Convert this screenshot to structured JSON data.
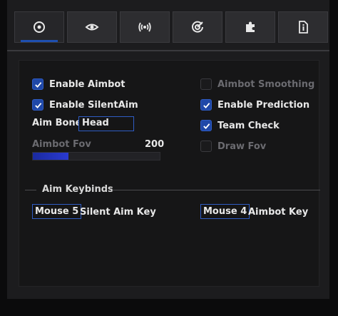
{
  "tabs": [
    {
      "icon": "target-icon",
      "active": true
    },
    {
      "icon": "eye-icon",
      "active": false
    },
    {
      "icon": "broadcast-icon",
      "active": false
    },
    {
      "icon": "crosshair-icon",
      "active": false
    },
    {
      "icon": "puzzle-icon",
      "active": false
    },
    {
      "icon": "info-icon",
      "active": false
    }
  ],
  "left": {
    "enable_aimbot": {
      "label": "Enable Aimbot",
      "checked": true
    },
    "enable_silentaim": {
      "label": "Enable SilentAim",
      "checked": true
    },
    "aim_bone": {
      "label": "Aim Bone",
      "value": "Head"
    },
    "aimbot_fov": {
      "label": "Aimbot Fov",
      "value": "200",
      "fill_fraction": 0.28
    }
  },
  "right": {
    "aimbot_smoothing": {
      "label": "Aimbot Smoothing",
      "checked": false
    },
    "enable_prediction": {
      "label": "Enable Prediction",
      "checked": true
    },
    "team_check": {
      "label": "Team Check",
      "checked": true
    },
    "draw_fov": {
      "label": "Draw Fov",
      "checked": false
    }
  },
  "keybinds": {
    "section_title": "Aim Keybinds",
    "silent": {
      "key": "Mouse 5",
      "label": "Silent Aim Key"
    },
    "aimbot": {
      "key": "Mouse 4",
      "label": "Aimbot Key"
    }
  },
  "colors": {
    "accent": "#1f48a8",
    "tab_indicator": "#1e4fb0"
  }
}
